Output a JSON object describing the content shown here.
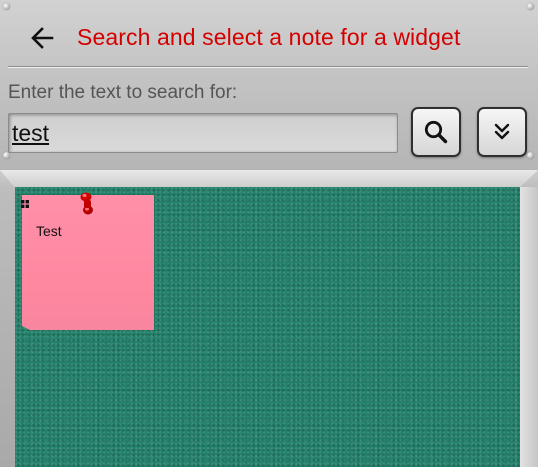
{
  "header": {
    "title": "Search and select a note for a widget",
    "search_prompt": "Enter the text to search for:",
    "search_value": "test"
  },
  "buttons": {
    "back_icon": "arrow-left-icon",
    "search_icon": "magnifier-icon",
    "expand_icon": "double-chevron-down-icon"
  },
  "colors": {
    "title": "#d40000",
    "board": "#207e68",
    "note": "#ff8fa8"
  },
  "notes": [
    {
      "text": "Test",
      "color": "pink",
      "pinned": true
    }
  ]
}
